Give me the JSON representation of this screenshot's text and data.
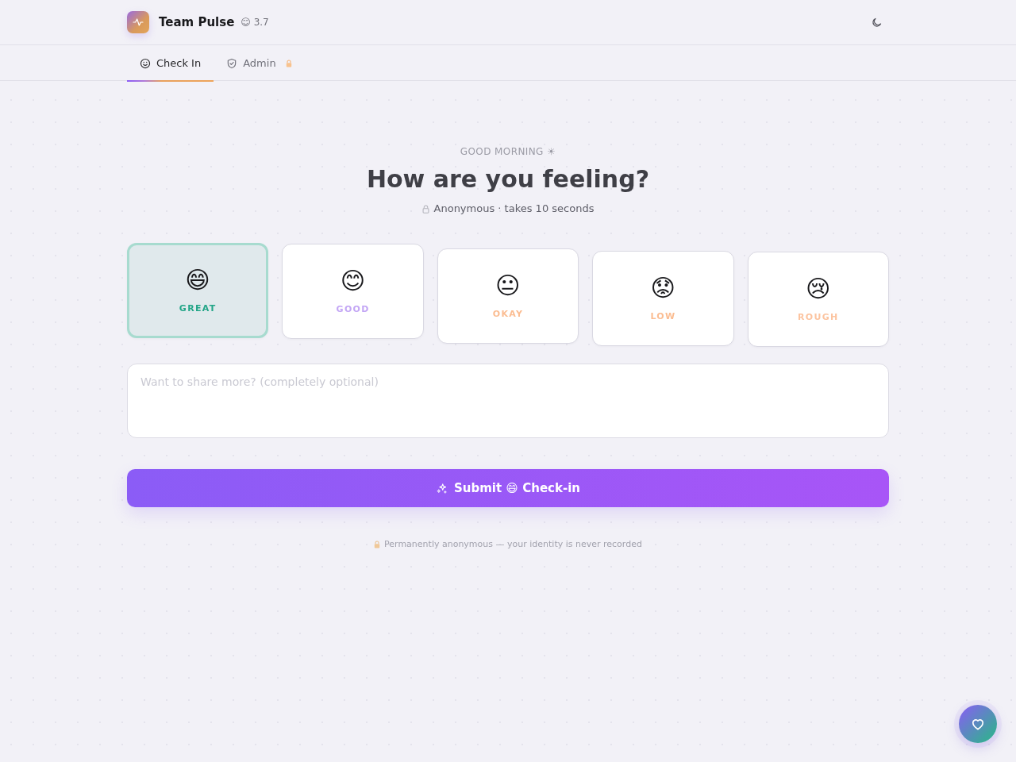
{
  "app": {
    "name": "Team Pulse",
    "score": "😊 3.7"
  },
  "tabs": [
    {
      "label": "Check In",
      "selected": true,
      "locked": false
    },
    {
      "label": "Admin",
      "selected": false,
      "locked": true
    }
  ],
  "hero": {
    "greeting": "GOOD MORNING ☀",
    "title": "How are you feeling?",
    "subtitle": "Anonymous · takes 10 seconds"
  },
  "moods": [
    {
      "emoji": "😄",
      "label": "GREAT",
      "color": "#22a587",
      "selected": true
    },
    {
      "emoji": "😊",
      "label": "GOOD",
      "color": "#c3a6f5",
      "selected": false
    },
    {
      "emoji": "😐",
      "label": "OKAY",
      "color": "#fbbd92",
      "selected": false
    },
    {
      "emoji": "😟",
      "label": "LOW",
      "color": "#fbbd92",
      "selected": false
    },
    {
      "emoji": "😢",
      "label": "ROUGH",
      "color": "#fcc4a0",
      "selected": false
    }
  ],
  "note": {
    "placeholder": "Want to share more? (completely optional)"
  },
  "submit": {
    "label": "Submit 😄 Check-in"
  },
  "footer": {
    "text": "Permanently anonymous — your identity is never recorded"
  }
}
